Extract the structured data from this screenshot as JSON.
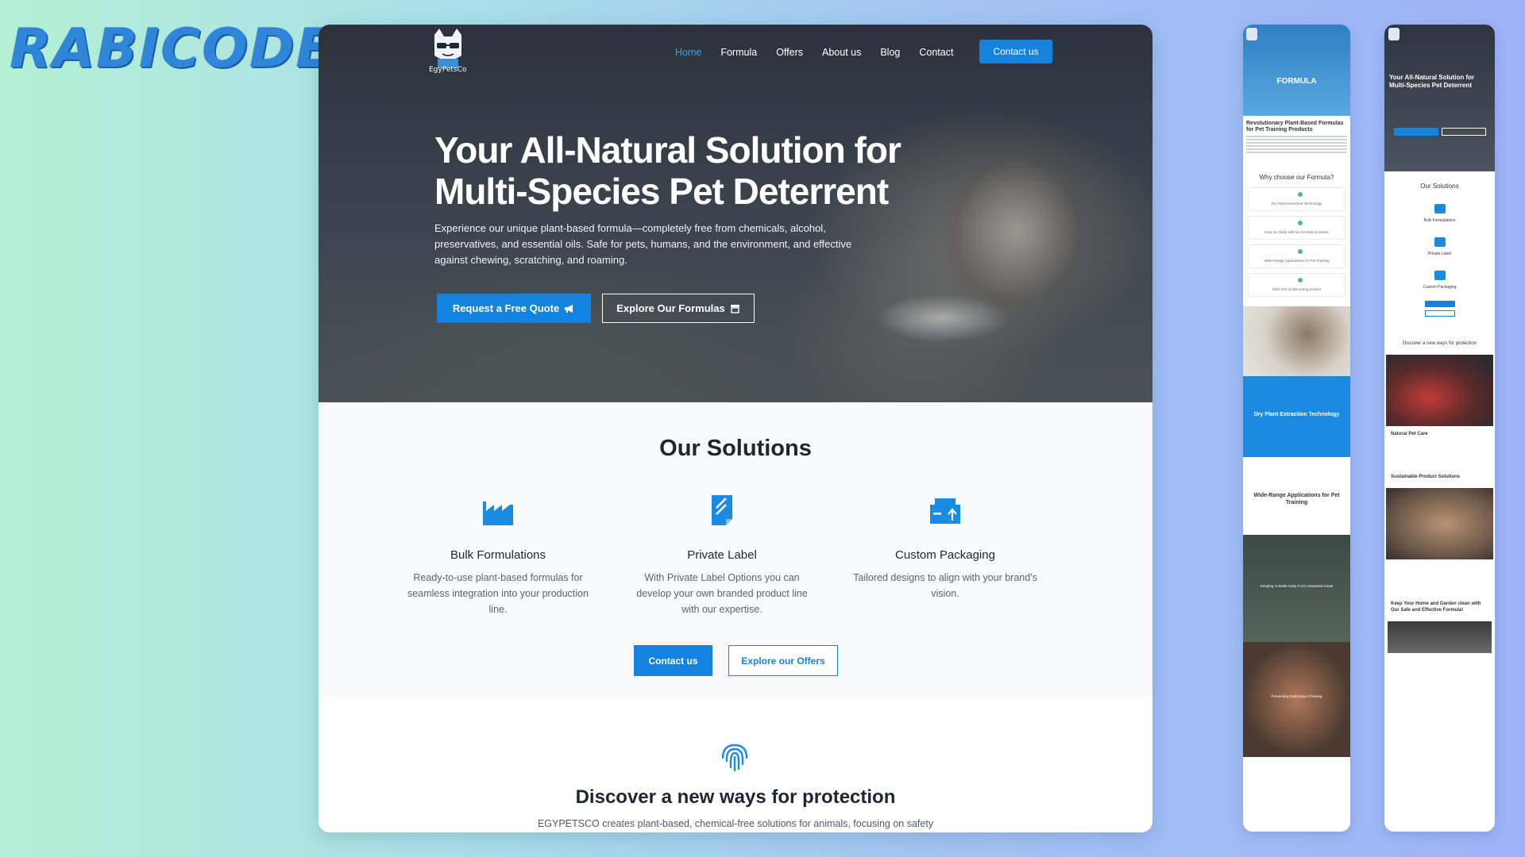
{
  "brand": {
    "logo_text": "RABICODES"
  },
  "site": {
    "logo_caption": "EgyPetsCo",
    "nav": {
      "links": [
        "Home",
        "Formula",
        "Offers",
        "About us",
        "Blog",
        "Contact"
      ],
      "active": "Home",
      "cta": "Contact us"
    },
    "hero": {
      "title": "Your All-Natural Solution for Multi-Species Pet Deterrent",
      "description": "Experience our unique plant-based formula—completely free from chemicals, alcohol, preservatives, and essential oils. Safe for pets, humans, and the environment, and effective against chewing, scratching, and roaming.",
      "primary_button": "Request a Free Quote",
      "secondary_button": "Explore Our Formulas"
    },
    "solutions": {
      "title": "Our Solutions",
      "items": [
        {
          "icon": "factory-icon",
          "title": "Bulk Formulations",
          "text": "Ready-to-use plant-based formulas for seamless integration into your production line."
        },
        {
          "icon": "label-icon",
          "title": "Private Label",
          "text": "With Private Label Options you can develop your own branded product line with our expertise."
        },
        {
          "icon": "packaging-icon",
          "title": "Custom Packaging",
          "text": "Tailored designs to align with your brand's vision."
        }
      ],
      "contact_button": "Contact us",
      "offers_button": "Explore our Offers"
    },
    "discover": {
      "icon": "fingerprint-icon",
      "title": "Discover a new ways for protection",
      "text": "EGYPETSCO creates plant-based, chemical-free solutions for animals, focusing on safety"
    }
  },
  "phone1": {
    "hero_label": "FORMULA",
    "heading": "Revolutionary Plant-Based Formulas for Pet Training Products",
    "why_title": "Why choose our Formula?",
    "checks": [
      "Dry Plant Extraction Technology",
      "Easy to Clean with No Alcohols & Stains",
      "Wide-Range Applications for Pet Training",
      "Odor-free & fast-acting product"
    ],
    "blue_title": "Dry Plant Extraction Technology",
    "white_title": "Wide-Range Applications for Pet Training",
    "dark_caption": "Keeping Animals Away From Unwanted Areas",
    "dog_caption": "Preventing Destructive Chewing"
  },
  "phone2": {
    "hero_title": "Your All-Natural Solution for Multi-Species Pet Deterrent",
    "solutions_title": "Our Solutions",
    "items": [
      "Bulk Formulations",
      "Private Label",
      "Custom Packaging"
    ],
    "discover_title": "Discover a new ways for protection",
    "care_title": "Natural Pet Care",
    "sustainable_title": "Sustainable Product Solutions",
    "keep_title": "Keep Your Home and Garden clean with Our Safe and Effective Formula!"
  },
  "colors": {
    "accent": "#1483e0",
    "accent_light": "#3aa1f0",
    "brand_logo": "#2f86d8"
  }
}
